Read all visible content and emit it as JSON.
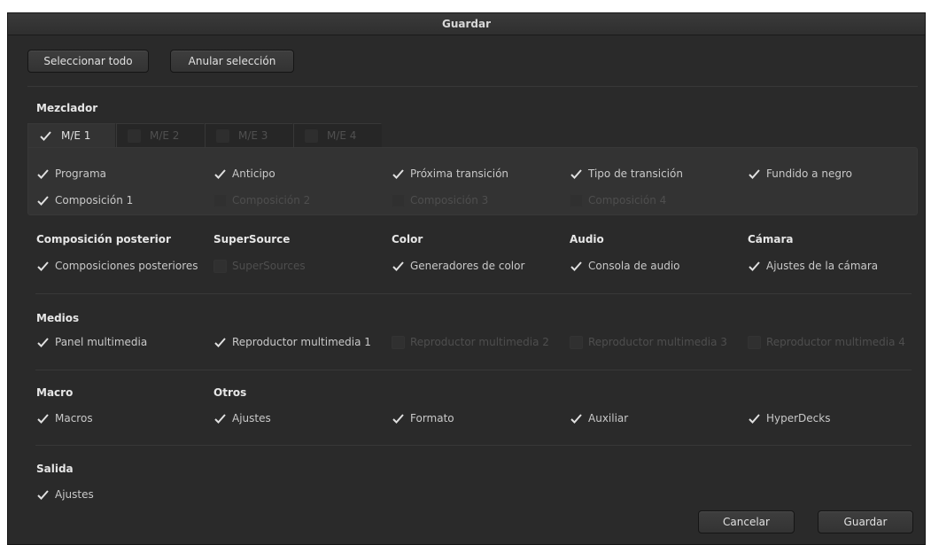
{
  "dialog": {
    "title": "Guardar"
  },
  "top_buttons": {
    "select_all": "Seleccionar todo",
    "deselect": "Anular selección"
  },
  "mixer": {
    "heading": "Mezclador",
    "tabs": [
      {
        "label": "M/E 1",
        "checked": true
      },
      {
        "label": "M/E 2",
        "checked": false
      },
      {
        "label": "M/E 3",
        "checked": false
      },
      {
        "label": "M/E 4",
        "checked": false
      }
    ],
    "items": [
      {
        "label": "Programa",
        "checked": true
      },
      {
        "label": "Anticipo",
        "checked": true
      },
      {
        "label": "Próxima transición",
        "checked": true
      },
      {
        "label": "Tipo de transición",
        "checked": true
      },
      {
        "label": "Fundido a negro",
        "checked": true
      },
      {
        "label": "Composición 1",
        "checked": true
      },
      {
        "label": "Composición 2",
        "checked": false
      },
      {
        "label": "Composición 3",
        "checked": false
      },
      {
        "label": "Composición 4",
        "checked": false
      }
    ]
  },
  "row2": {
    "downstream": {
      "heading": "Composición posterior",
      "item": "Composiciones posteriores",
      "checked": true
    },
    "supersource": {
      "heading": "SuperSource",
      "item": "SuperSources",
      "checked": false
    },
    "color": {
      "heading": "Color",
      "item": "Generadores de color",
      "checked": true
    },
    "audio": {
      "heading": "Audio",
      "item": "Consola de audio",
      "checked": true
    },
    "camera": {
      "heading": "Cámara",
      "item": "Ajustes de la cámara",
      "checked": true
    }
  },
  "media": {
    "heading": "Medios",
    "items": [
      {
        "label": "Panel multimedia",
        "checked": true
      },
      {
        "label": "Reproductor multimedia 1",
        "checked": true
      },
      {
        "label": "Reproductor multimedia 2",
        "checked": false
      },
      {
        "label": "Reproductor multimedia 3",
        "checked": false
      },
      {
        "label": "Reproductor multimedia 4",
        "checked": false
      }
    ]
  },
  "macro": {
    "heading": "Macro",
    "item": "Macros",
    "checked": true
  },
  "others": {
    "heading": "Otros",
    "items": [
      {
        "label": "Ajustes",
        "checked": true
      },
      {
        "label": "Formato",
        "checked": true
      },
      {
        "label": "Auxiliar",
        "checked": true
      },
      {
        "label": "HyperDecks",
        "checked": true
      }
    ]
  },
  "output": {
    "heading": "Salida",
    "item": "Ajustes",
    "checked": true
  },
  "footer": {
    "cancel": "Cancelar",
    "save": "Guardar"
  },
  "colors": {
    "background": "#2a2a2a",
    "checkmark": "#e0e0e0",
    "text": "#c9c9c9",
    "disabled_text": "#4e4e4e"
  }
}
